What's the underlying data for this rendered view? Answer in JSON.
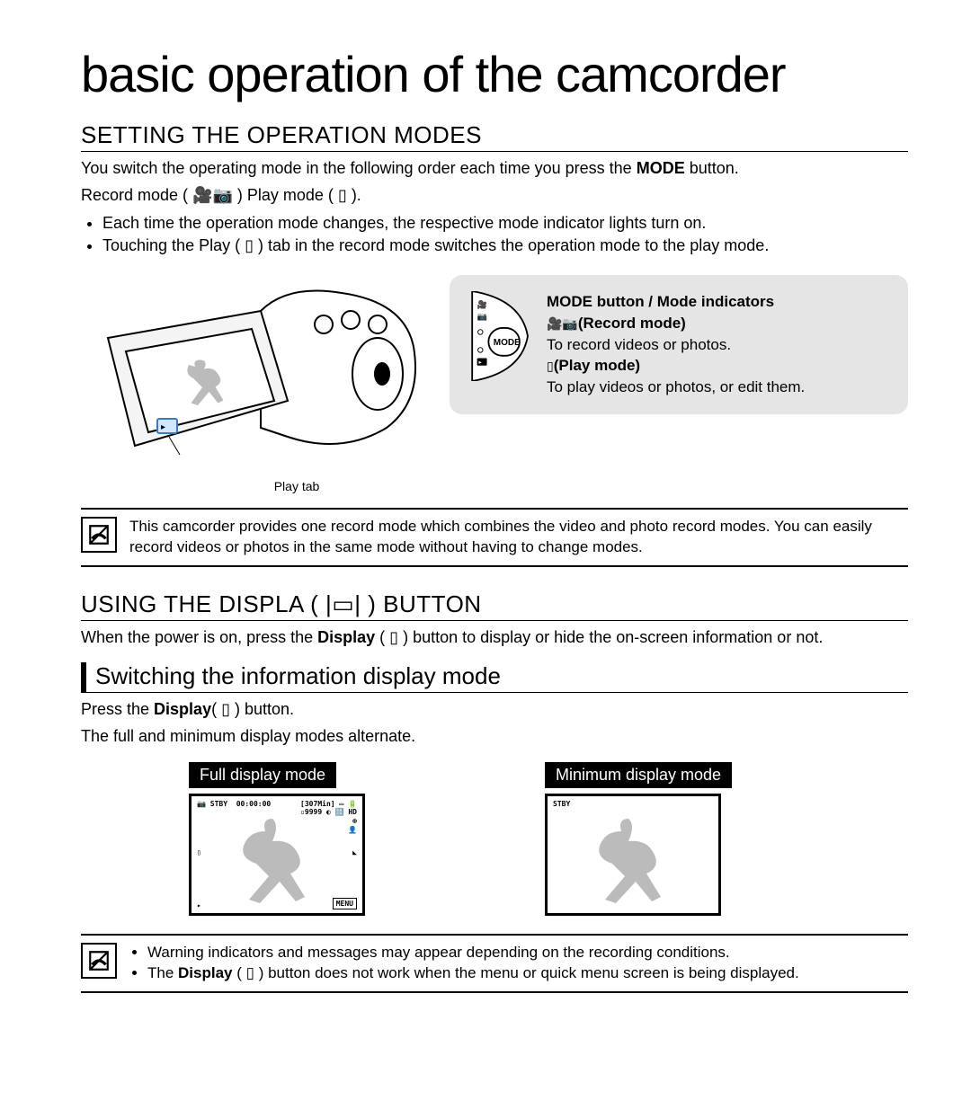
{
  "title": "basic operation of the camcorder",
  "section1": {
    "heading": "SETTING THE OPERATION MODES",
    "intro1_a": "You switch the operating mode in the following order each time you press the ",
    "intro1_bold": "MODE",
    "intro1_b": " button.",
    "intro2": "Record mode ( 🎥📷 )      Play mode ( ▯ ).",
    "bullets": [
      "Each time the operation mode changes, the respective mode indicator lights turn on.",
      "Touching the Play ( ▯ ) tab in the record mode switches the operation mode to the play mode."
    ],
    "playtab_label": "Play tab",
    "greybox": {
      "title": "MODE button / Mode indicators",
      "rec_label": "(Record mode)",
      "rec_desc": "To record videos or photos.",
      "play_label": "(Play mode)",
      "play_desc": "To play videos or photos, or edit them."
    },
    "note": "This camcorder provides one record mode which combines the video and photo record modes. You can easily record videos or photos in the same mode without having to change modes."
  },
  "section2": {
    "heading_a": "USING THE DISPLA ( ",
    "heading_b": " ) BUTTON",
    "intro_a": "When the power is on, press the ",
    "intro_bold": "Display",
    "intro_b": " ( ▯ ) button to display or hide the on-screen information or not.",
    "sub_heading": "Switching the information display mode",
    "press_a": "Press the ",
    "press_bold": "Display",
    "press_b": "( ▯ ) button.",
    "alternate": "The full and minimum display modes alternate.",
    "full_label": "Full display mode",
    "min_label": "Minimum display mode",
    "osd": {
      "stby": "STBY",
      "time": "00:00:00",
      "remain": "[307Min]",
      "count": "9999",
      "menu": "MENU"
    },
    "note_bullets": [
      "Warning indicators and messages may appear depending on the recording conditions.",
      "The Display ( ▯ ) button does not work when the menu or quick menu screen is being displayed."
    ],
    "note2_bold": "Display"
  }
}
